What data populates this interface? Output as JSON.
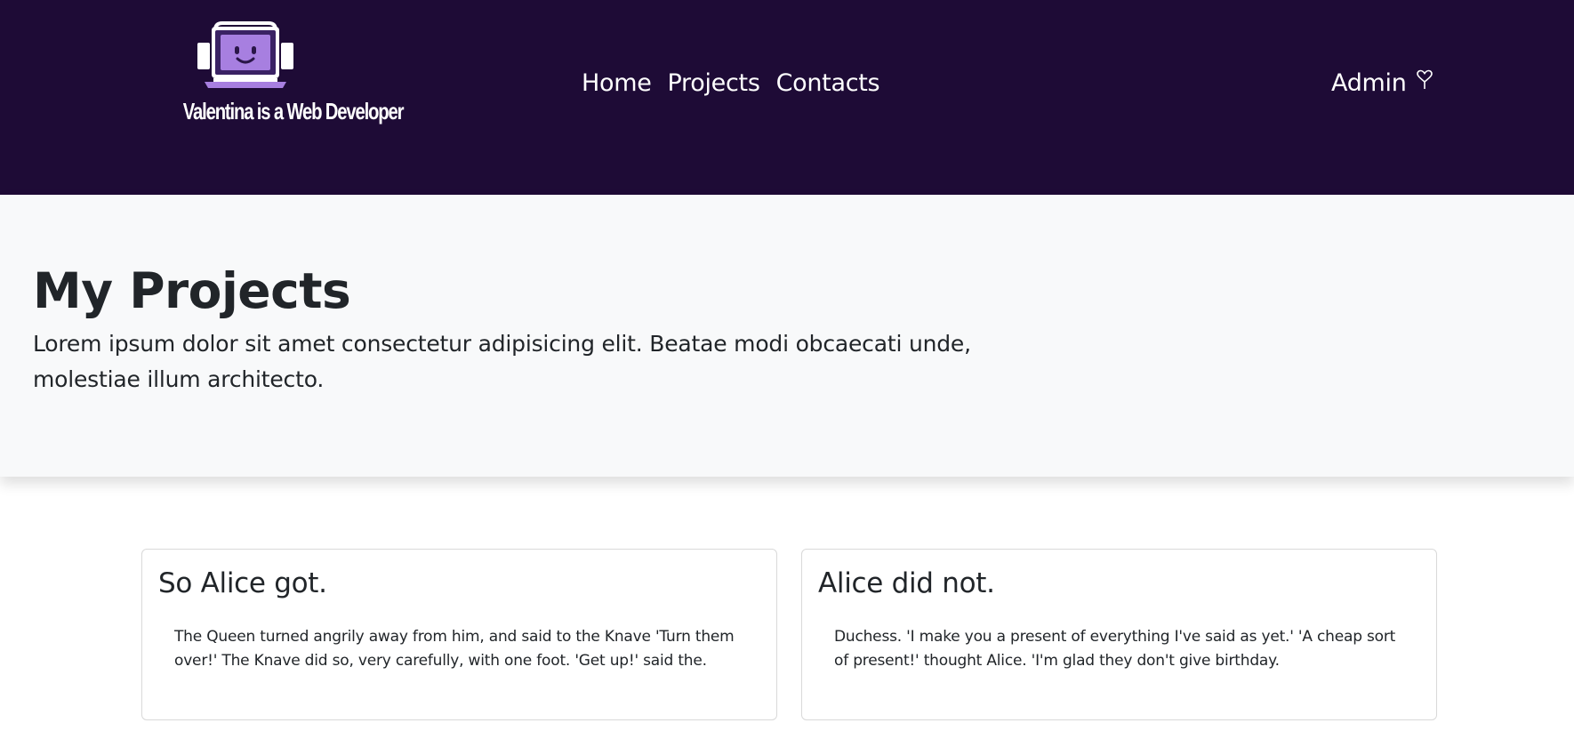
{
  "brand": {
    "text": "Valentina is a Web Developer",
    "logo_icon": "laptop-face-headphones-icon",
    "colors": {
      "screen": "#a77fe0",
      "frame": "#ffffff",
      "base": "#a77fe0"
    }
  },
  "nav": {
    "items": [
      {
        "label": "Home"
      },
      {
        "label": "Projects"
      },
      {
        "label": "Contacts"
      }
    ],
    "admin_label": "Admin",
    "admin_icon": "heart-outline-icon"
  },
  "hero": {
    "title": "My Projects",
    "description": "Lorem ipsum dolor sit amet consectetur adipisicing elit. Beatae modi obcaecati unde, molestiae illum architecto."
  },
  "cards": [
    {
      "title": "So Alice got.",
      "text": "The Queen turned angrily away from him, and said to the Knave 'Turn them over!' The Knave did so, very carefully, with one foot. 'Get up!' said the."
    },
    {
      "title": "Alice did not.",
      "text": "Duchess. 'I make you a present of everything I've said as yet.' 'A cheap sort of present!' thought Alice. 'I'm glad they don't give birthday."
    }
  ],
  "colors": {
    "navbar_bg": "#1e0b36",
    "hero_bg": "#f8f9fa",
    "text": "#212529"
  }
}
